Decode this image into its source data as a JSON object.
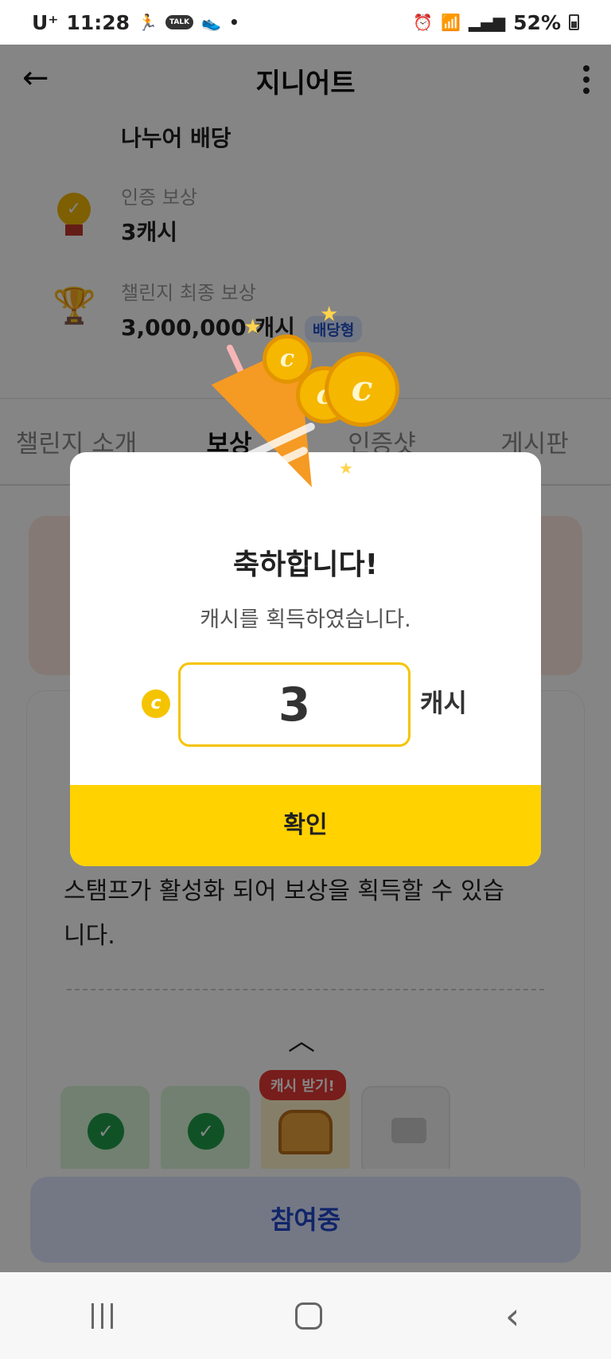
{
  "status_bar": {
    "carrier": "U⁺",
    "time": "11:28",
    "talk_label": "TALK",
    "battery": "52%"
  },
  "header": {
    "title": "지니어트"
  },
  "reward_info": {
    "dividend_heading": "나누어 배당",
    "cert_label": "인증 보상",
    "cert_value": "3캐시",
    "final_label": "챌린지 최종 보상",
    "final_value": "3,000,000 캐시",
    "final_badge": "배당형"
  },
  "tabs": [
    "챌린지 소개",
    "보상",
    "인증샷",
    "게시판"
  ],
  "card": {
    "desc_line_3": "스탬프가 활성화 되어 보상을 획득할 수 있습",
    "desc_line_4": "니다.",
    "cash_tag": "캐시 받기!"
  },
  "join_button": "참여중",
  "dialog": {
    "title": "축하합니다!",
    "subtitle": "캐시를 획득하였습니다.",
    "coin_symbol": "c",
    "amount": "3",
    "unit": "캐시",
    "confirm": "확인"
  },
  "colors": {
    "accent_yellow": "#ffd200",
    "join_blue": "#1f47c9",
    "stamp_green": "#1f9d4a"
  }
}
